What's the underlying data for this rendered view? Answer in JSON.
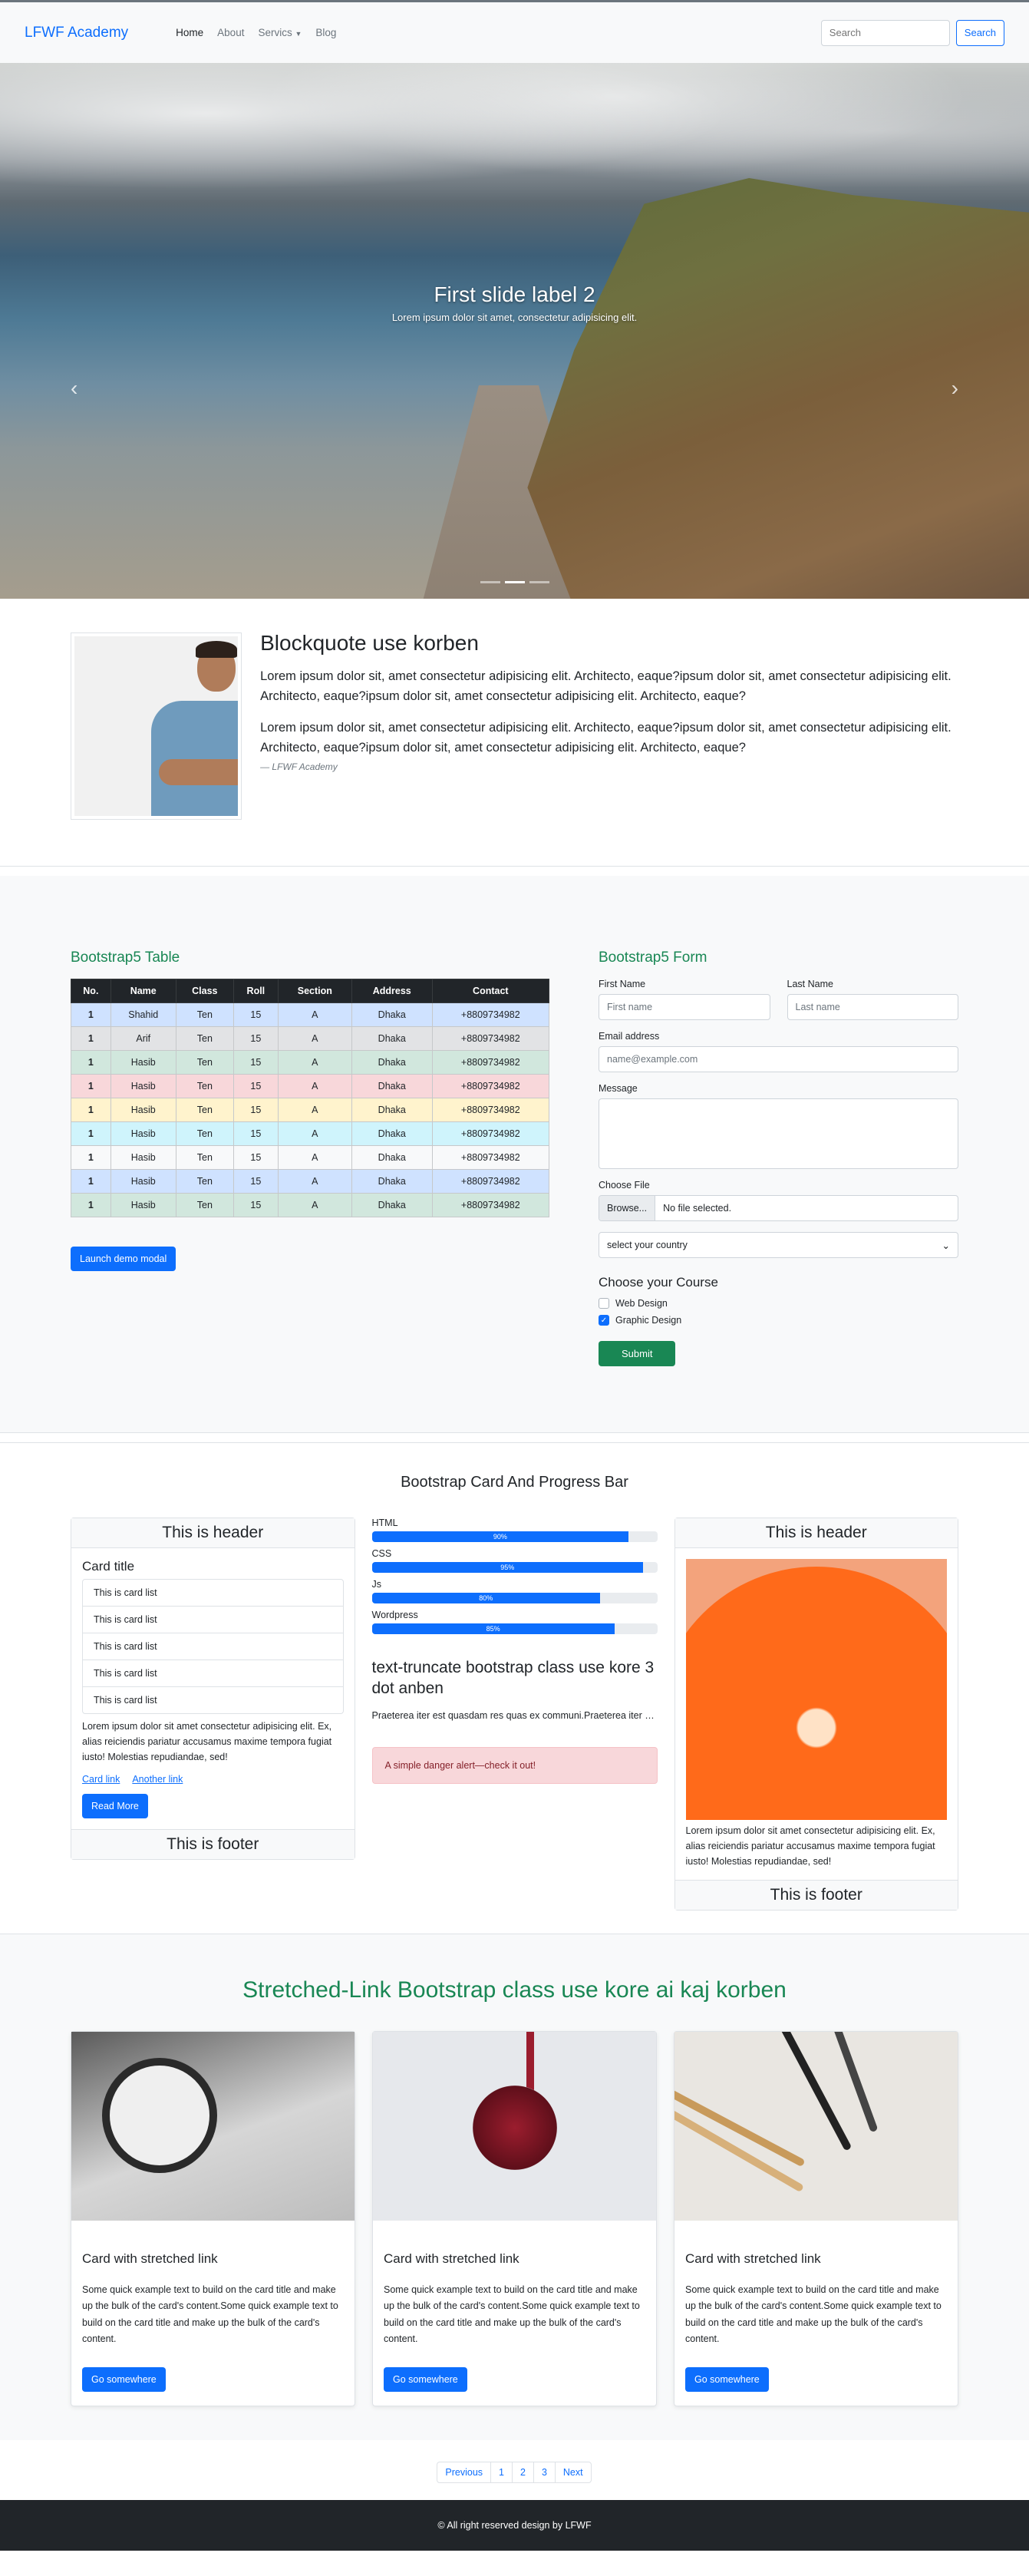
{
  "nav": {
    "brand": "LFWF Academy",
    "links": [
      "Home",
      "About",
      "Servics",
      "Blog"
    ],
    "search_placeholder": "Search",
    "search_button": "Search"
  },
  "hero": {
    "title": "First slide label 2",
    "text": "Lorem ipsum dolor sit amet, consectetur adipisicing elit.",
    "slides": 3,
    "active_slide": 2
  },
  "quote": {
    "title": "Blockquote use korben",
    "para1": "Lorem ipsum dolor sit, amet consectetur adipisicing elit. Architecto, eaque?ipsum dolor sit, amet consectetur adipisicing elit. Architecto, eaque?ipsum dolor sit, amet consectetur adipisicing elit. Architecto, eaque?",
    "para2": "Lorem ipsum dolor sit, amet consectetur adipisicing elit. Architecto, eaque?ipsum dolor sit, amet consectetur adipisicing elit. Architecto, eaque?ipsum dolor sit, amet consectetur adipisicing elit. Architecto, eaque?",
    "footer": "— LFWF Academy"
  },
  "table_section": {
    "title": "Bootstrap5 Table",
    "headers": [
      "No.",
      "Name",
      "Class",
      "Roll",
      "Section",
      "Address",
      "Contact"
    ],
    "rows": [
      [
        "1",
        "Shahid",
        "Ten",
        "15",
        "A",
        "Dhaka",
        "+8809734982"
      ],
      [
        "1",
        "Arif",
        "Ten",
        "15",
        "A",
        "Dhaka",
        "+8809734982"
      ],
      [
        "1",
        "Hasib",
        "Ten",
        "15",
        "A",
        "Dhaka",
        "+8809734982"
      ],
      [
        "1",
        "Hasib",
        "Ten",
        "15",
        "A",
        "Dhaka",
        "+8809734982"
      ],
      [
        "1",
        "Hasib",
        "Ten",
        "15",
        "A",
        "Dhaka",
        "+8809734982"
      ],
      [
        "1",
        "Hasib",
        "Ten",
        "15",
        "A",
        "Dhaka",
        "+8809734982"
      ],
      [
        "1",
        "Hasib",
        "Ten",
        "15",
        "A",
        "Dhaka",
        "+8809734982"
      ],
      [
        "1",
        "Hasib",
        "Ten",
        "15",
        "A",
        "Dhaka",
        "+8809734982"
      ],
      [
        "1",
        "Hasib",
        "Ten",
        "15",
        "A",
        "Dhaka",
        "+8809734982"
      ]
    ],
    "row_variants": [
      "r0",
      "r1",
      "r2",
      "r3",
      "r4",
      "r5",
      "r6",
      "r0",
      "r2"
    ],
    "modal_button": "Launch demo modal"
  },
  "form": {
    "title": "Bootstrap5 Form",
    "first_label": "First Name",
    "first_placeholder": "First name",
    "last_label": "Last Name",
    "last_placeholder": "Last name",
    "email_label": "Email address",
    "email_placeholder": "name@example.com",
    "message_label": "Message",
    "file_label": "Choose File",
    "file_button": "Browse...",
    "file_status": "No file selected.",
    "country_select": "select your country",
    "course_title": "Choose your Course",
    "courses": [
      {
        "label": "Web Design",
        "checked": false
      },
      {
        "label": "Graphic Design",
        "checked": true
      }
    ],
    "submit": "Submit"
  },
  "cards_section": {
    "title": "Bootstrap Card And Progress Bar",
    "left_card": {
      "header": "This is header",
      "title": "Card title",
      "list": [
        "This is card list",
        "This is card list",
        "This is card list",
        "This is card list",
        "This is card list"
      ],
      "text": "Lorem ipsum dolor sit amet consectetur adipisicing elit. Ex, alias reiciendis pariatur accusamus maxime tempora fugiat iusto! Molestias repudiandae, sed!",
      "link1": "Card link",
      "link2": "Another link",
      "button": "Read More",
      "footer": "This is footer"
    },
    "progress": [
      {
        "label": "HTML",
        "value": 90,
        "text": "90%"
      },
      {
        "label": "CSS",
        "value": 95,
        "text": "95%"
      },
      {
        "label": "Js",
        "value": 80,
        "text": "80%"
      },
      {
        "label": "Wordpress",
        "value": 85,
        "text": "85%"
      }
    ],
    "trunc_title": "text-truncate bootstrap class use kore 3 dot anben",
    "trunc_text": "Praeterea iter est quasdam res quas ex communi.Praeterea iter est quasdam res quas ex communi.",
    "alert": "A simple danger alert—check it out!",
    "right_card": {
      "header": "This is header",
      "text": "Lorem ipsum dolor sit amet consectetur adipisicing elit. Ex, alias reiciendis pariatur accusamus maxime tempora fugiat iusto! Molestias repudiandae, sed!",
      "footer": "This is footer"
    }
  },
  "stretched": {
    "title": "Stretched-Link Bootstrap class use kore ai kaj korben",
    "card_title": "Card with stretched link",
    "card_text": "Some quick example text to build on the card title and make up the bulk of the card's content.Some quick example text to build on the card title and make up the bulk of the card's content.",
    "button": "Go somewhere"
  },
  "pagination": [
    "Previous",
    "1",
    "2",
    "3",
    "Next"
  ],
  "footer": "© All right reserved design by LFWF",
  "colors": {
    "primary": "#0d6efd",
    "success": "#198754",
    "dark": "#212529",
    "light": "#f8f9fa"
  }
}
